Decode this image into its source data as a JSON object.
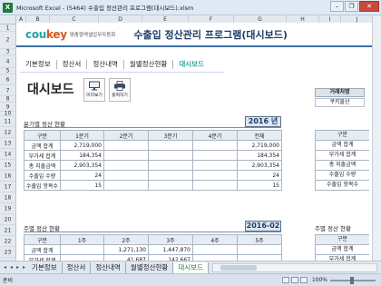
{
  "window": {
    "title": "Microsoft Excel - (5464) 수출입 정산관리 프로그램(대시보드).xlsm",
    "icon": "excel-icon",
    "controls": [
      "minimize",
      "restore",
      "close"
    ]
  },
  "columns": [
    "A",
    "B",
    "C",
    "D",
    "E",
    "F",
    "G",
    "H",
    "I",
    "J",
    "K"
  ],
  "rows": [
    "1",
    "2",
    "3",
    "4",
    "5",
    "6",
    "7",
    "8",
    "9",
    "10",
    "11",
    "12",
    "13",
    "14",
    "15",
    "16",
    "17",
    "18",
    "19",
    "20",
    "21",
    "22",
    "23",
    "24"
  ],
  "banner": {
    "logo_main": "cou",
    "logo_accent": "key",
    "logo_sub": "맞춤형엑셀업무자동화",
    "app_title": "수출입 정산관리 프로그램(대시보드)"
  },
  "nav": {
    "items": [
      "기본정보",
      "정산서",
      "정산내역",
      "월별정산현황",
      "대시보드"
    ],
    "active_index": 4
  },
  "dashboard": {
    "title": "대시보드",
    "preview_label": "미리보기",
    "print_label": "출력하기",
    "partner_header": "거래처명",
    "partner_value": "쿠키물산"
  },
  "quarterly": {
    "title": "분기별 정산 현황",
    "year": "2016 년",
    "headers": [
      "구분",
      "1분기",
      "2분기",
      "3분기",
      "4분기",
      "전체"
    ],
    "rows": [
      [
        "금액 합계",
        "2,719,000",
        "",
        "",
        "",
        "2,719,000"
      ],
      [
        "부가세 합계",
        "184,354",
        "",
        "",
        "",
        "184,354"
      ],
      [
        "총 지출금액",
        "2,903,354",
        "",
        "",
        "",
        "2,903,354"
      ],
      [
        "수출입 수량",
        "24",
        "",
        "",
        "",
        "24"
      ],
      [
        "수출입 항목수",
        "15",
        "",
        "",
        "",
        "15"
      ]
    ],
    "side_header": "구분",
    "side_rows": [
      "금액 합계",
      "부가세 합계",
      "총 지출금액",
      "수출입 수량",
      "수출입 항목수"
    ]
  },
  "weekly": {
    "title": "주별 정산 현황",
    "month": "2016-02",
    "headers": [
      "구분",
      "1주",
      "2주",
      "3주",
      "4주",
      "5주"
    ],
    "rows": [
      [
        "금액 합계",
        "",
        "1,271,130",
        "1,447,870",
        "",
        ""
      ],
      [
        "부가세 합계",
        "",
        "41,687",
        "142,667",
        "",
        ""
      ]
    ],
    "side_title": "주별 정산 현황",
    "side_header": "구분",
    "side_rows": [
      "금액 합계",
      "부가세 합계"
    ]
  },
  "sheet_tabs": {
    "items": [
      "기본정보",
      "정산서",
      "정산내역",
      "월별정산현황",
      "대시보드"
    ],
    "active_index": 4,
    "nav_glyphs": [
      "◂",
      "◂",
      "▸",
      "▸"
    ]
  },
  "status": {
    "ready": "준비",
    "zoom": "100%"
  }
}
